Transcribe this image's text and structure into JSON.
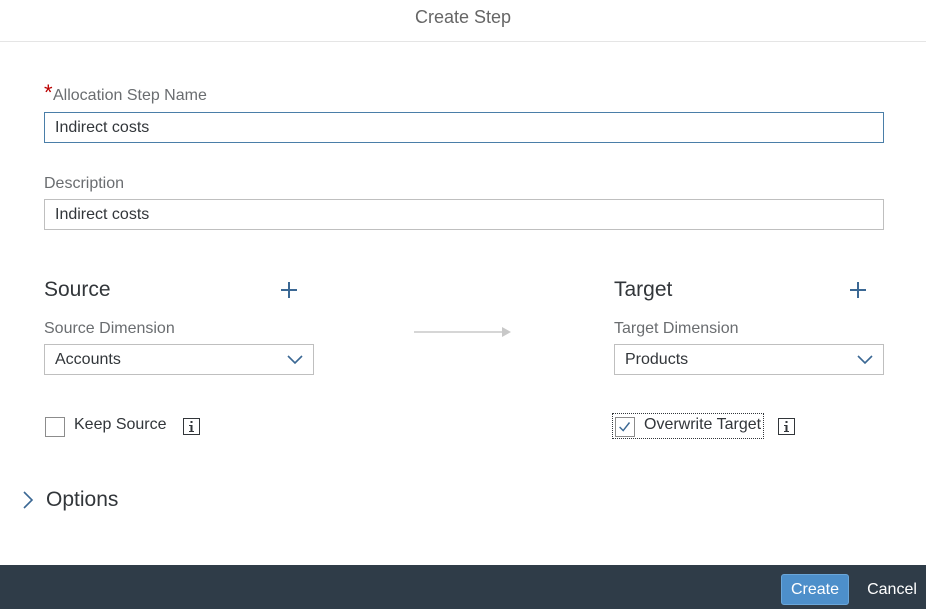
{
  "dialog": {
    "title": "Create Step"
  },
  "form": {
    "step_name": {
      "label": "Allocation Step Name",
      "required_mark": "*",
      "value": "Indirect costs"
    },
    "description": {
      "label": "Description",
      "value": "Indirect costs"
    }
  },
  "source": {
    "title": "Source",
    "dimension_label": "Source Dimension",
    "dimension_value": "Accounts",
    "keep_source_label": "Keep Source",
    "keep_source_checked": false
  },
  "target": {
    "title": "Target",
    "dimension_label": "Target Dimension",
    "dimension_value": "Products",
    "overwrite_label": "Overwrite Target",
    "overwrite_checked": true
  },
  "options": {
    "label": "Options"
  },
  "footer": {
    "create_label": "Create",
    "cancel_label": "Cancel"
  },
  "colors": {
    "accent": "#4d8fca",
    "icon": "#3b6894",
    "footer": "#2f3c48",
    "required": "#bb0000"
  }
}
